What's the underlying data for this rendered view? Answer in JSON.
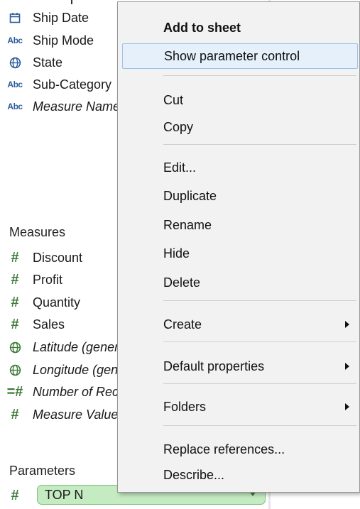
{
  "data_pane": {
    "dimensions": [
      {
        "label": "Ship Date",
        "icon": "calendar-icon",
        "italic": false
      },
      {
        "label": "Ship Mode",
        "icon": "abc-string-icon",
        "italic": false
      },
      {
        "label": "State",
        "icon": "globe-icon",
        "italic": false
      },
      {
        "label": "Sub-Category",
        "icon": "abc-string-icon",
        "italic": false
      },
      {
        "label": "Measure Names",
        "icon": "abc-string-icon",
        "italic": true
      }
    ],
    "abc_glyph": "Abc",
    "measures_title": "Measures",
    "measures": [
      {
        "label": "Discount",
        "icon": "hash-icon",
        "italic": false
      },
      {
        "label": "Profit",
        "icon": "hash-icon",
        "italic": false
      },
      {
        "label": "Quantity",
        "icon": "hash-icon",
        "italic": false
      },
      {
        "label": "Sales",
        "icon": "hash-icon",
        "italic": false
      },
      {
        "label": "Latitude (generated)",
        "icon": "globe-icon",
        "italic": true
      },
      {
        "label": "Longitude (generated)",
        "icon": "globe-icon",
        "italic": true
      },
      {
        "label": "Number of Records",
        "icon": "calc-hash-icon",
        "italic": true
      },
      {
        "label": "Measure Values",
        "icon": "hash-icon",
        "italic": true
      }
    ],
    "parameters_title": "Parameters",
    "parameter": {
      "label": "TOP N",
      "icon": "hash-icon"
    }
  },
  "context_menu": {
    "items": {
      "add_to_sheet": "Add to sheet",
      "show_parameter_control": "Show parameter control",
      "cut": "Cut",
      "copy": "Copy",
      "edit": "Edit...",
      "duplicate": "Duplicate",
      "rename": "Rename",
      "hide": "Hide",
      "delete": "Delete",
      "create": "Create",
      "default_properties": "Default properties",
      "folders": "Folders",
      "replace_references": "Replace references...",
      "describe": "Describe..."
    },
    "highlighted_item": "Show parameter control"
  },
  "colors": {
    "dimension_icon": "#2e5c9a",
    "measure_icon": "#3e7a3a",
    "parameter_pill": "#c4ebc1",
    "menu_background": "#f2f2f2",
    "menu_hover": "#e5f0fb"
  }
}
